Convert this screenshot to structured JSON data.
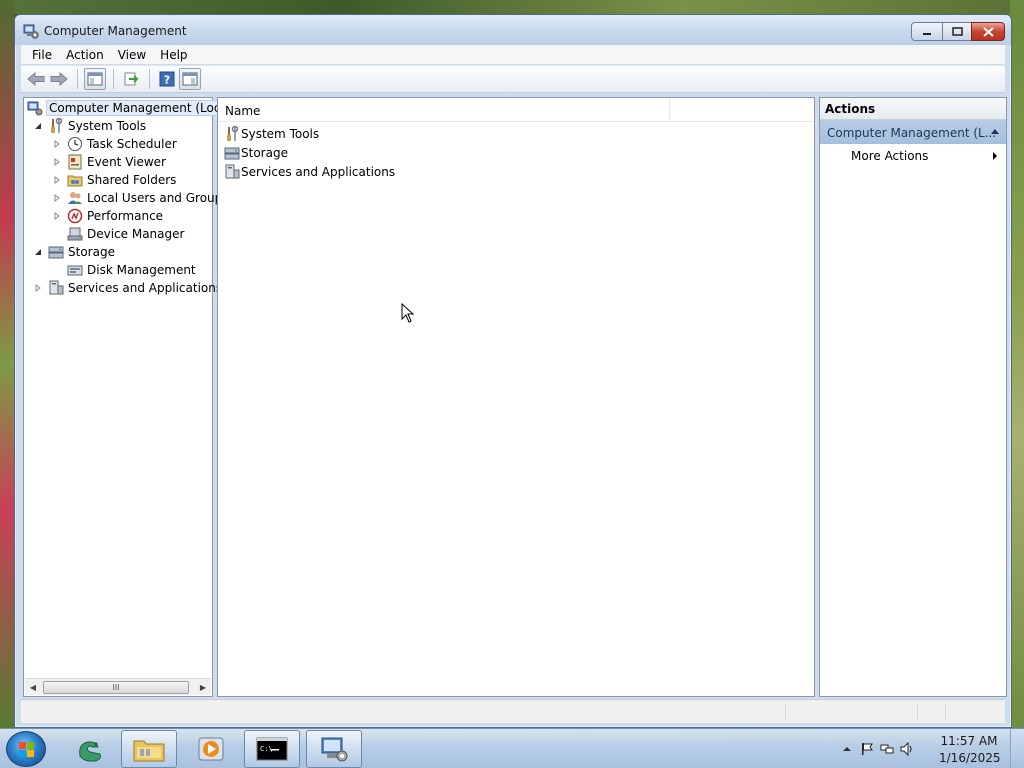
{
  "window": {
    "title": "Computer Management",
    "buttons": {
      "minimize": "minimize",
      "maximize": "maximize",
      "close": "close"
    }
  },
  "menu": [
    "File",
    "Action",
    "View",
    "Help"
  ],
  "toolbar": {
    "icons": [
      "back-arrow-icon",
      "forward-arrow-icon",
      "show-hide-console-tree-icon",
      "export-list-icon",
      "help-icon",
      "show-hide-action-pane-icon"
    ]
  },
  "tree": {
    "root": "Computer Management (Local",
    "items": [
      {
        "label": "System Tools",
        "level": 1,
        "expanded": true
      },
      {
        "label": "Task Scheduler",
        "level": 2,
        "expandable": true
      },
      {
        "label": "Event Viewer",
        "level": 2,
        "expandable": true
      },
      {
        "label": "Shared Folders",
        "level": 2,
        "expandable": true
      },
      {
        "label": "Local Users and Groups",
        "level": 2,
        "expandable": true
      },
      {
        "label": "Performance",
        "level": 2,
        "expandable": true
      },
      {
        "label": "Device Manager",
        "level": 2,
        "expandable": false
      },
      {
        "label": "Storage",
        "level": 1,
        "expanded": true
      },
      {
        "label": "Disk Management",
        "level": 2,
        "expandable": false
      },
      {
        "label": "Services and Applications",
        "level": 1,
        "expandable": true
      }
    ],
    "scroll_thumb_glyph": "III"
  },
  "list": {
    "columns": [
      "Name",
      ""
    ],
    "rows": [
      "System Tools",
      "Storage",
      "Services and Applications"
    ]
  },
  "actions": {
    "header": "Actions",
    "section": "Computer Management (L...",
    "items": [
      "More Actions"
    ]
  },
  "taskbar": {
    "apps": [
      "start-orb",
      "python-app",
      "file-explorer",
      "media-player",
      "command-prompt",
      "computer-management"
    ],
    "active_app": "computer-management",
    "clock": {
      "time": "11:57 AM",
      "date": "1/16/2025"
    }
  },
  "colors": {
    "selection": "#e1ecf8",
    "actions_section": "#a4bfdd",
    "taskbar": "#b7cde6"
  }
}
